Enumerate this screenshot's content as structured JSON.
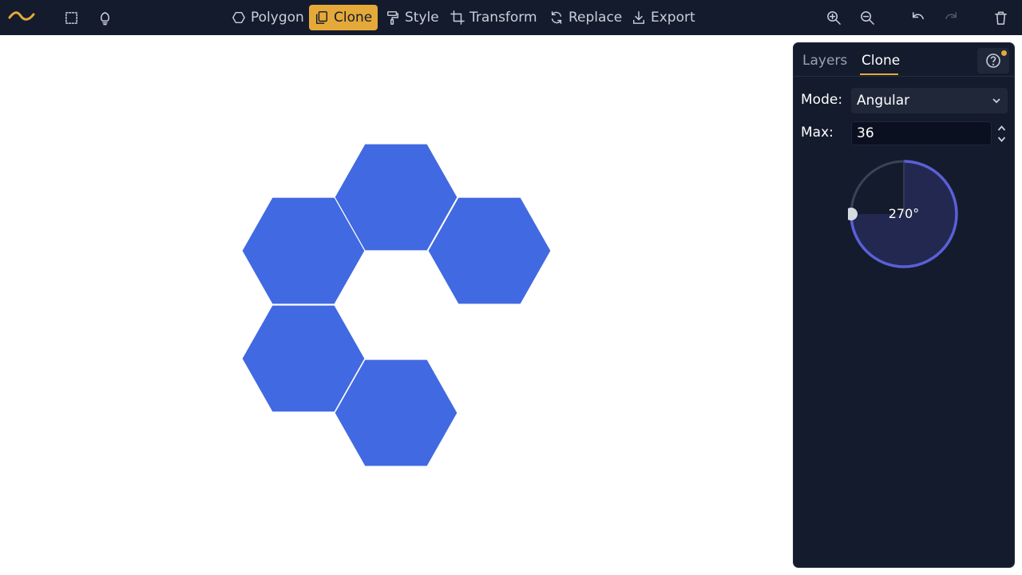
{
  "toolbar": {
    "logo_icon": "wave-logo",
    "left_icons": [
      "select-box-icon",
      "lightbulb-icon"
    ],
    "tools": [
      {
        "label": "Polygon",
        "icon": "hexagon-icon",
        "active": false
      },
      {
        "label": "Clone",
        "icon": "clone-icon",
        "active": true
      },
      {
        "label": "Style",
        "icon": "paint-roller-icon",
        "active": false
      },
      {
        "label": "Transform",
        "icon": "crop-icon",
        "active": false
      },
      {
        "label": "Replace",
        "icon": "refresh-icon",
        "active": false
      },
      {
        "label": "Export",
        "icon": "download-icon",
        "active": false
      }
    ],
    "right_icons": [
      "zoom-in-icon",
      "zoom-out-icon",
      "undo-icon",
      "redo-icon",
      "trash-icon"
    ],
    "accent_color": "#e5a93a",
    "background_color": "#141b2d"
  },
  "canvas": {
    "shape_color": "#4169e1",
    "shape_count": 5,
    "shape_type": "hexagon"
  },
  "panel": {
    "tabs": [
      {
        "label": "Layers",
        "active": false
      },
      {
        "label": "Clone",
        "active": true
      }
    ],
    "help_icon": "help-circle-icon",
    "mode": {
      "label": "Mode:",
      "value": "Angular"
    },
    "max": {
      "label": "Max:",
      "value": "36"
    },
    "angle": {
      "value": 270,
      "display": "270°"
    },
    "dial_color": "#5b5fd6"
  }
}
